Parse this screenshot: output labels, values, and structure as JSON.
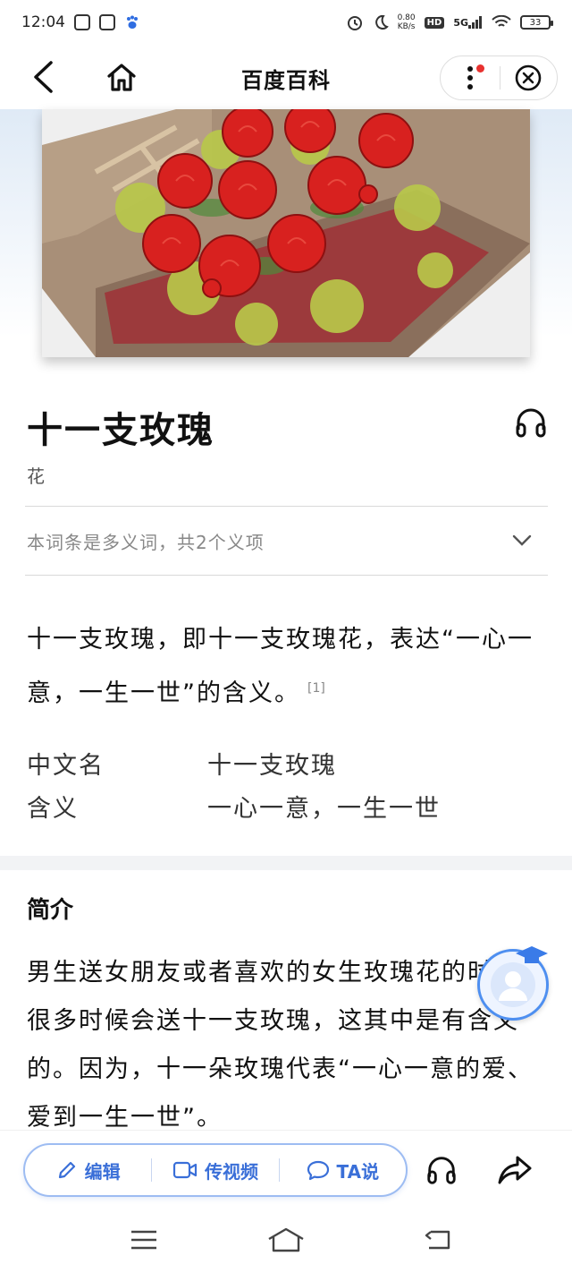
{
  "status_bar": {
    "time": "12:04",
    "net_speed_value": "0.80",
    "net_speed_unit": "KB/s",
    "hd": "HD",
    "signal": "5G",
    "battery": "33"
  },
  "header": {
    "title": "百度百科"
  },
  "entry": {
    "title": "十一支玫瑰",
    "subtitle": "花",
    "polysemy_notice": "本词条是多义词，共2个义项"
  },
  "summary": {
    "text": "十一支玫瑰，即十一支玫瑰花，表达“一心一意，一生一世”的含义。",
    "citation": "[1]"
  },
  "infobox": [
    {
      "key": "中文名",
      "value": "十一支玫瑰"
    },
    {
      "key": "含义",
      "value": "一心一意，一生一世"
    }
  ],
  "intro": {
    "title": "简介",
    "text": "男生送女朋友或者喜欢的女生玫瑰花的时候，很多时候会送十一支玫瑰，这其中是有含义的。因为，十一朵玫瑰代表“一心一意的爱、爱到一生一世”。"
  },
  "actions": {
    "edit_label": "编辑",
    "upload_video_label": "传视频",
    "ta_say_label": "TA说"
  },
  "colors": {
    "accent_blue": "#3a6fd8",
    "notification_red": "#e8312f"
  }
}
